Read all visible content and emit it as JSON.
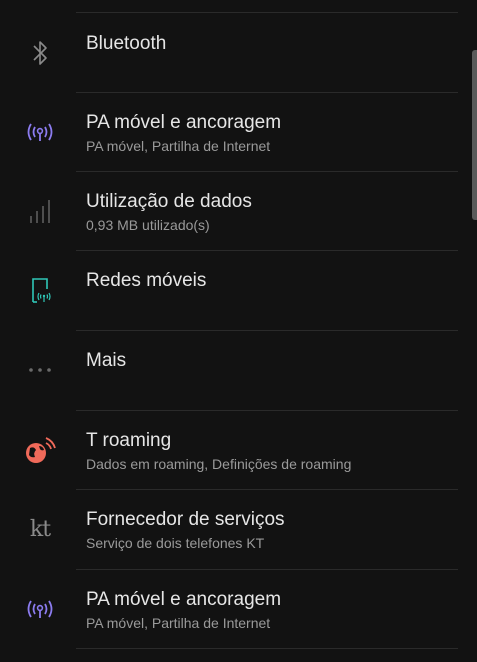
{
  "items": [
    {
      "title": "Bluetooth",
      "subtitle": "",
      "icon": "bluetooth-icon"
    },
    {
      "title": "PA móvel e ancoragem",
      "subtitle": "PA móvel, Partilha de Internet",
      "icon": "hotspot-icon"
    },
    {
      "title": "Utilização de dados",
      "subtitle": "0,93 MB utilizado(s)",
      "icon": "data-usage-icon"
    },
    {
      "title": "Redes móveis",
      "subtitle": "",
      "icon": "mobile-networks-icon"
    },
    {
      "title": "Mais",
      "subtitle": "",
      "icon": "more-icon"
    },
    {
      "title": "T roaming",
      "subtitle": "Dados em roaming, Definições de roaming",
      "icon": "t-roaming-icon"
    },
    {
      "title": "Fornecedor de serviços",
      "subtitle": "Serviço de dois telefones KT",
      "icon": "kt-icon"
    },
    {
      "title": "PA móvel e ancoragem",
      "subtitle": "PA móvel, Partilha de Internet",
      "icon": "hotspot-icon"
    }
  ],
  "icon_labels": {
    "kt": "kt"
  },
  "colors": {
    "background": "#121212",
    "title": "#e6e6e6",
    "subtitle": "#9a9a9a",
    "hotspot": "#8c7cf0",
    "mobile_networks": "#2fc7b7",
    "t_roaming": "#f06a5a"
  }
}
